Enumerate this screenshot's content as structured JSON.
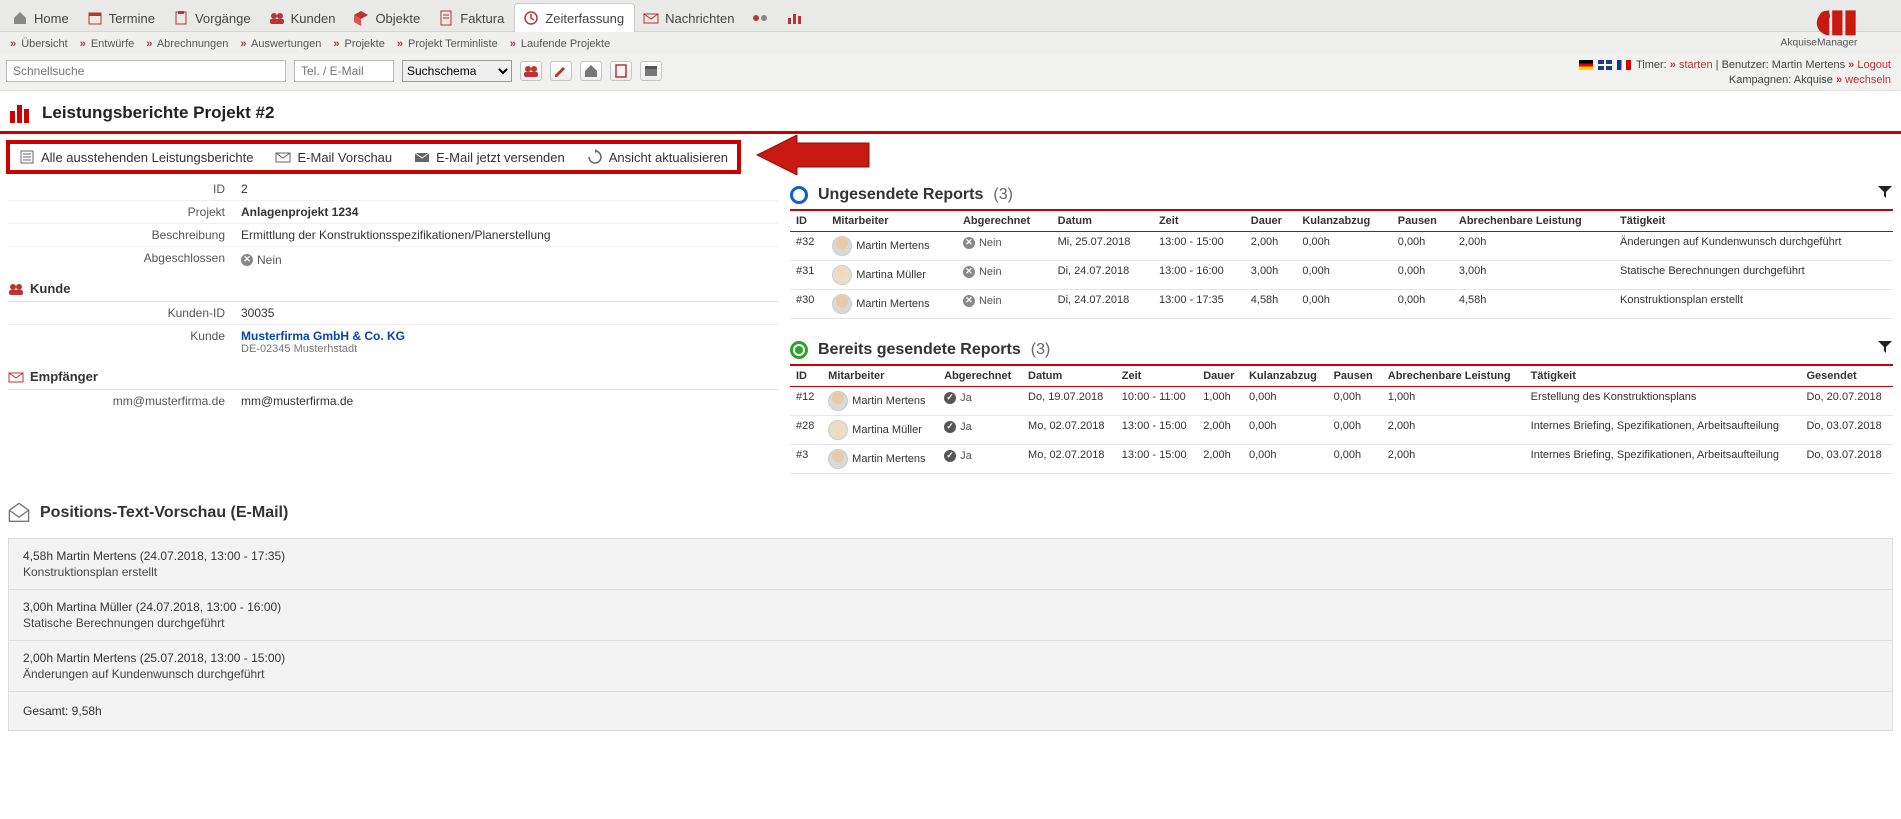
{
  "nav": {
    "tabs": [
      {
        "label": "Home",
        "icon": "home"
      },
      {
        "label": "Termine",
        "icon": "calendar"
      },
      {
        "label": "Vorgänge",
        "icon": "clipboard"
      },
      {
        "label": "Kunden",
        "icon": "users"
      },
      {
        "label": "Objekte",
        "icon": "cube"
      },
      {
        "label": "Faktura",
        "icon": "invoice"
      },
      {
        "label": "Zeiterfassung",
        "icon": "clock",
        "active": true
      },
      {
        "label": "Nachrichten",
        "icon": "mail"
      }
    ],
    "subnav": [
      "Übersicht",
      "Entwürfe",
      "Abrechnungen",
      "Auswertungen",
      "Projekte",
      "Projekt Terminliste",
      "Laufende Projekte"
    ]
  },
  "toolbar": {
    "search_placeholder": "Schnellsuche",
    "tel_placeholder": "Tel. / E-Mail",
    "select_label": "Suchschema"
  },
  "userinfo": {
    "timer_label": "Timer:",
    "timer_action": "starten",
    "user_label": "Benutzer: Martin Mertens",
    "logout": "Logout",
    "campaign_label": "Kampagnen: Akquise",
    "campaign_action": "wechseln"
  },
  "brand": {
    "name": "AkquiseManager"
  },
  "page": {
    "title": "Leistungsberichte Projekt #2"
  },
  "actions": {
    "a1": "Alle ausstehenden Leistungsberichte",
    "a2": "E-Mail Vorschau",
    "a3": "E-Mail jetzt versenden",
    "a4": "Ansicht aktualisieren"
  },
  "details": {
    "id_label": "ID",
    "id": "2",
    "project_label": "Projekt",
    "project": "Anlagenprojekt 1234",
    "desc_label": "Beschreibung",
    "desc": "Ermittlung der Konstruktionsspezifikationen/Planerstellung",
    "done_label": "Abgeschlossen",
    "done": "Nein",
    "kunde_section": "Kunde",
    "kunden_id_label": "Kunden-ID",
    "kunden_id": "30035",
    "kunde_label": "Kunde",
    "kunde_name": "Musterfirma GmbH & Co. KG",
    "kunde_addr": "DE-02345 Musterhstadt",
    "empf_section": "Empfänger",
    "empf_key": "mm@musterfirma.de",
    "empf_val": "mm@musterfirma.de"
  },
  "reports": {
    "unsent": {
      "title": "Ungesendete Reports",
      "count": "(3)",
      "headers": [
        "ID",
        "Mitarbeiter",
        "Abgerechnet",
        "Datum",
        "Zeit",
        "Dauer",
        "Kulanzabzug",
        "Pausen",
        "Abrechenbare Leistung",
        "Tätigkeit"
      ],
      "rows": [
        {
          "id": "#32",
          "emp": "Martin Mertens",
          "abg": "Nein",
          "date": "Mi, 25.07.2018",
          "time": "13:00 - 15:00",
          "dur": "2,00h",
          "kul": "0,00h",
          "pau": "0,00h",
          "abl": "2,00h",
          "tat": "Änderungen auf Kundenwunsch durchgeführt",
          "avatar": "m"
        },
        {
          "id": "#31",
          "emp": "Martina Müller",
          "abg": "Nein",
          "date": "Di, 24.07.2018",
          "time": "13:00 - 16:00",
          "dur": "3,00h",
          "kul": "0,00h",
          "pau": "0,00h",
          "abl": "3,00h",
          "tat": "Statische Berechnungen durchgeführt",
          "avatar": "f"
        },
        {
          "id": "#30",
          "emp": "Martin Mertens",
          "abg": "Nein",
          "date": "Di, 24.07.2018",
          "time": "13:00 - 17:35",
          "dur": "4,58h",
          "kul": "0,00h",
          "pau": "0,00h",
          "abl": "4,58h",
          "tat": "Konstruktionsplan erstellt",
          "avatar": "m"
        }
      ]
    },
    "sent": {
      "title": "Bereits gesendete Reports",
      "count": "(3)",
      "headers": [
        "ID",
        "Mitarbeiter",
        "Abgerechnet",
        "Datum",
        "Zeit",
        "Dauer",
        "Kulanzabzug",
        "Pausen",
        "Abrechenbare Leistung",
        "Tätigkeit",
        "Gesendet"
      ],
      "rows": [
        {
          "id": "#12",
          "emp": "Martin Mertens",
          "abg": "Ja",
          "date": "Do, 19.07.2018",
          "time": "10:00 - 11:00",
          "dur": "1,00h",
          "kul": "0,00h",
          "pau": "0,00h",
          "abl": "1,00h",
          "tat": "Erstellung des Konstruktionsplans",
          "sent": "Do, 20.07.2018",
          "avatar": "m"
        },
        {
          "id": "#28",
          "emp": "Martina Müller",
          "abg": "Ja",
          "date": "Mo, 02.07.2018",
          "time": "13:00 - 15:00",
          "dur": "2,00h",
          "kul": "0,00h",
          "pau": "0,00h",
          "abl": "2,00h",
          "tat": "Internes Briefing, Spezifikationen, Arbeitsaufteilung",
          "sent": "Do, 03.07.2018",
          "avatar": "f"
        },
        {
          "id": "#3",
          "emp": "Martin Mertens",
          "abg": "Ja",
          "date": "Mo, 02.07.2018",
          "time": "13:00 - 15:00",
          "dur": "2,00h",
          "kul": "0,00h",
          "pau": "0,00h",
          "abl": "2,00h",
          "tat": "Internes Briefing, Spezifikationen, Arbeitsaufteilung",
          "sent": "Do, 03.07.2018",
          "avatar": "m"
        }
      ]
    }
  },
  "preview": {
    "title": "Positions-Text-Vorschau (E-Mail)",
    "items": [
      {
        "line": "4,58h Martin Mertens (24.07.2018, 13:00 - 17:35)",
        "sub": "Konstruktionsplan erstellt"
      },
      {
        "line": "3,00h Martina Müller (24.07.2018, 13:00 - 16:00)",
        "sub": "Statische Berechnungen durchgeführt"
      },
      {
        "line": "2,00h Martin Mertens (25.07.2018, 13:00 - 15:00)",
        "sub": "Änderungen auf Kundenwunsch durchgeführt"
      }
    ],
    "total": "Gesamt: 9,58h"
  }
}
